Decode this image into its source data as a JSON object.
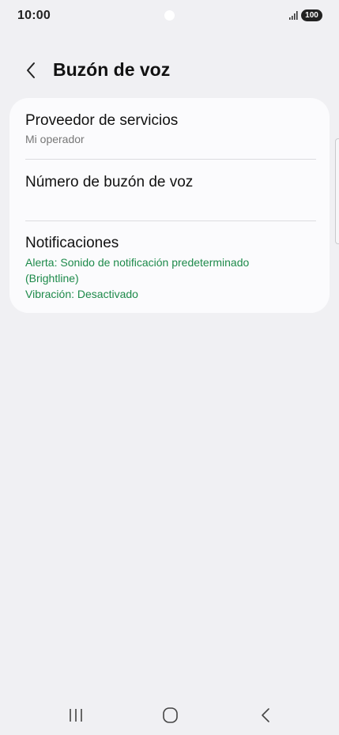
{
  "status_bar": {
    "time": "10:00",
    "battery": "100",
    "signal_icon": "signal-bars-icon"
  },
  "header": {
    "back_icon": "chevron-left-icon",
    "title": "Buzón de voz"
  },
  "settings": {
    "service_provider": {
      "title": "Proveedor de servicios",
      "subtitle": "Mi operador"
    },
    "voicemail_number": {
      "title": "Número de buzón de voz"
    },
    "notifications": {
      "title": "Notificaciones",
      "alert_line1": "Alerta: Sonido de notificación predeterminado",
      "alert_line2": "(Brightline)",
      "vibration": "Vibración: Desactivado"
    }
  },
  "colors": {
    "background": "#f0f0f3",
    "card": "#fbfbfd",
    "accent_green": "#1d8a4a",
    "secondary_text": "#777777"
  },
  "nav_bar": {
    "recents_icon": "recents-icon",
    "home_icon": "home-icon",
    "back_icon": "back-icon"
  }
}
